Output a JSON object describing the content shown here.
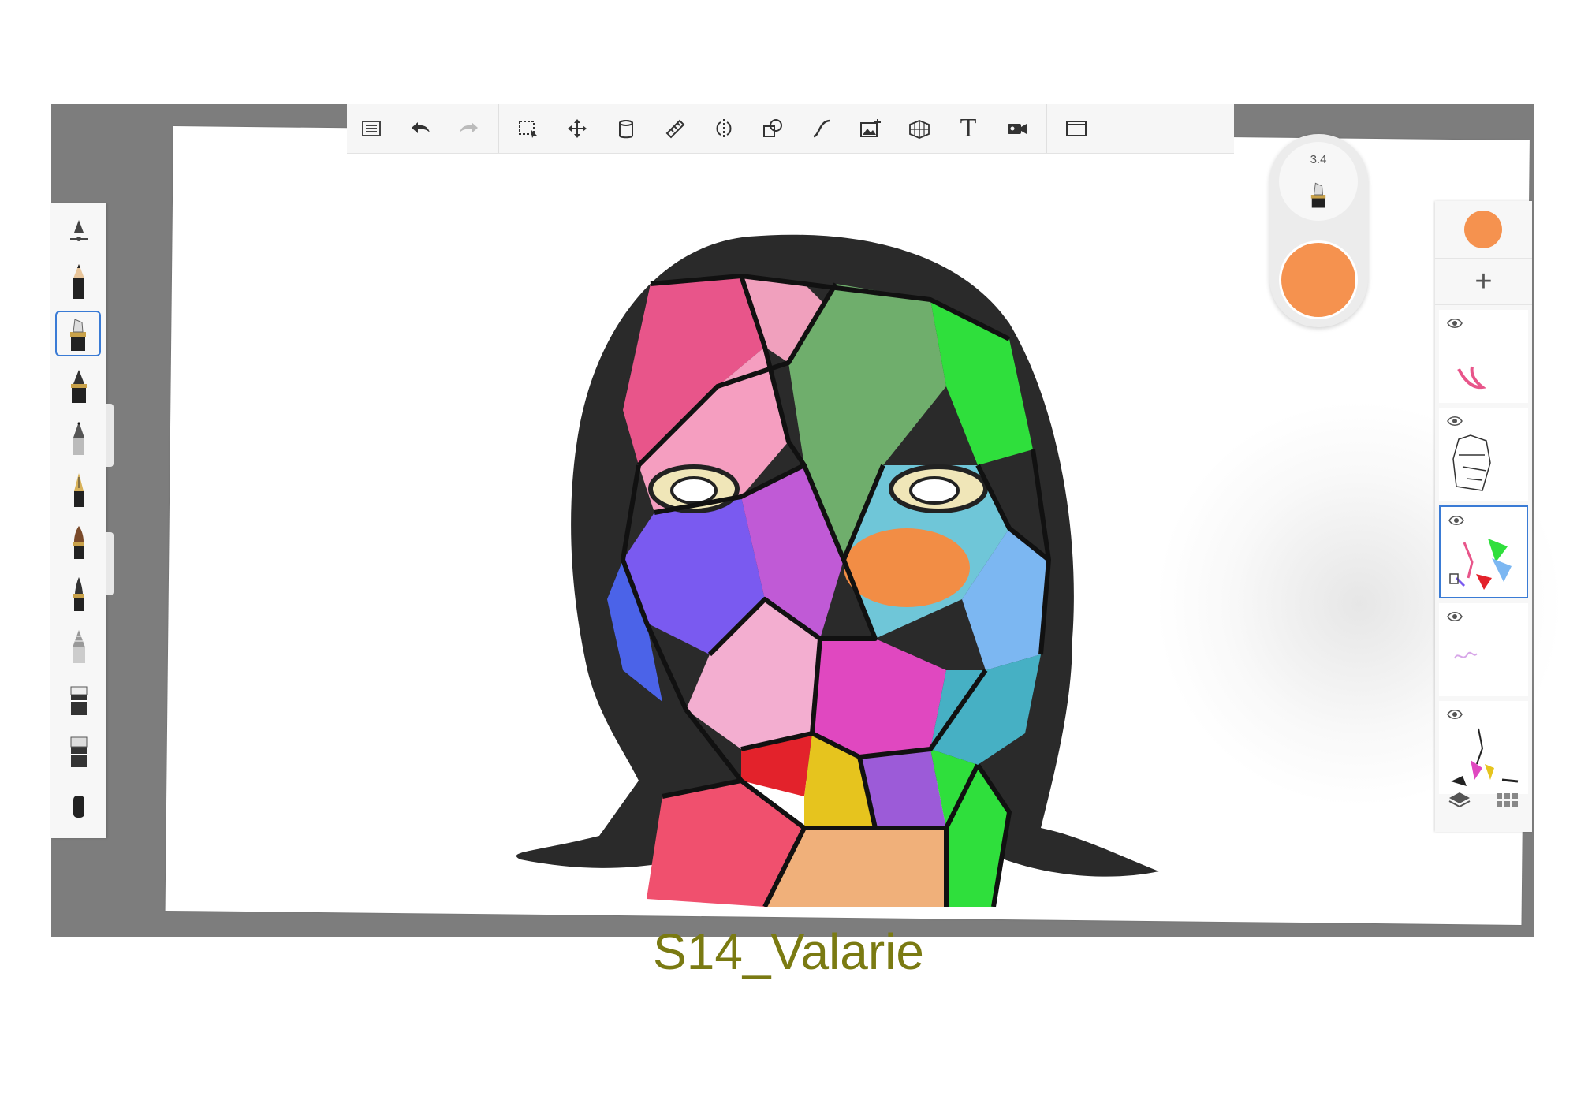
{
  "toolbar": {
    "items": [
      "layers-menu",
      "undo",
      "redo",
      "selection",
      "transform",
      "fill",
      "ruler",
      "symmetry",
      "shapes",
      "curve",
      "import-image",
      "perspective",
      "text",
      "recording",
      "fullscreen"
    ],
    "text_tool_label": "T"
  },
  "brushes": [
    "brush-settings",
    "pencil",
    "marker",
    "ink-pen",
    "ballpoint",
    "fountain-pen",
    "paintbrush",
    "fine-brush",
    "airbrush",
    "smudge",
    "eraser",
    "soft-eraser",
    "more"
  ],
  "selected_brush": "marker",
  "puck": {
    "brush_size": "3.4",
    "color": "#f5924f"
  },
  "layers": {
    "color": "#f5924f",
    "add_label": "+",
    "items": [
      {
        "name": "layer-1",
        "visible": true,
        "selected": false
      },
      {
        "name": "layer-2",
        "visible": true,
        "selected": false
      },
      {
        "name": "layer-3",
        "visible": true,
        "selected": true,
        "locked": true
      },
      {
        "name": "layer-4",
        "visible": true,
        "selected": false
      },
      {
        "name": "layer-5",
        "visible": true,
        "selected": false
      }
    ]
  },
  "caption": "S14_Valarie"
}
